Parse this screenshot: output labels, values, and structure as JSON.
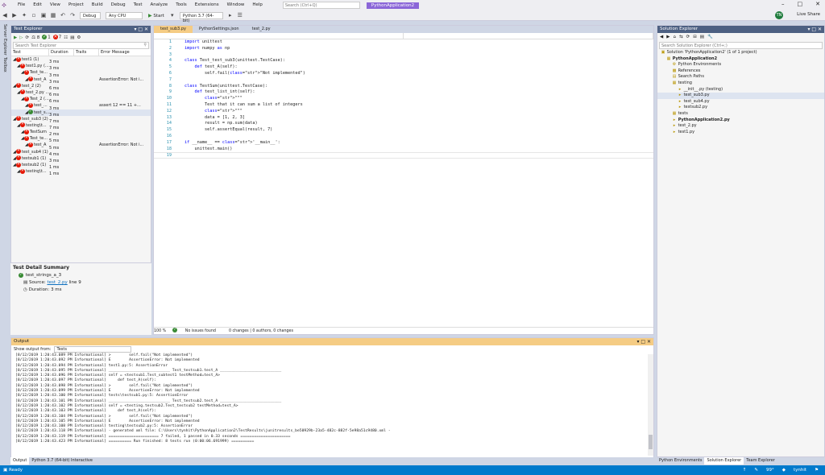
{
  "menubar": {
    "items": [
      "File",
      "Edit",
      "View",
      "Project",
      "Build",
      "Debug",
      "Test",
      "Analyze",
      "Tools",
      "Extensions",
      "Window",
      "Help"
    ],
    "search_placeholder": "Search (Ctrl+Q)",
    "solution_name": "PythonApplication2"
  },
  "toolbar": {
    "config": "Debug",
    "platform": "Any CPU",
    "start": "Start",
    "env": "Python 3.7 (64-bit)",
    "avatar_initials": "TN",
    "live_share": "Live Share"
  },
  "left_strip": [
    "Server Explorer",
    "Toolbox"
  ],
  "test_explorer": {
    "title": "Test Explorer",
    "counts": {
      "total": "8",
      "passed": "1",
      "failed": "7"
    },
    "search_placeholder": "Search Test Explorer",
    "columns": [
      "Test",
      "Duration",
      "Traits",
      "Error Message"
    ],
    "rows": [
      {
        "name": "test1 (1)",
        "duration": "3 ms",
        "traits": "",
        "error": "",
        "status": "fail",
        "indent": 0
      },
      {
        "name": "test1.py (...",
        "duration": "3 ms",
        "traits": "",
        "error": "",
        "status": "fail",
        "indent": 1
      },
      {
        "name": "Test_te...",
        "duration": "3 ms",
        "traits": "",
        "error": "",
        "status": "fail",
        "indent": 2
      },
      {
        "name": "test_A",
        "duration": "3 ms",
        "traits": "",
        "error": "AssertionError: Not i...",
        "status": "fail",
        "indent": 3
      },
      {
        "name": "test_2 (2)",
        "duration": "6 ms",
        "traits": "",
        "error": "",
        "status": "fail",
        "indent": 0
      },
      {
        "name": "test_2.py ...",
        "duration": "6 ms",
        "traits": "",
        "error": "",
        "status": "fail",
        "indent": 1
      },
      {
        "name": "Test_2 (...",
        "duration": "6 ms",
        "traits": "",
        "error": "",
        "status": "fail",
        "indent": 2
      },
      {
        "name": "test_...",
        "duration": "3 ms",
        "traits": "",
        "error": "assert 12 == 11 +...",
        "status": "fail",
        "indent": 3
      },
      {
        "name": "test_s...",
        "duration": "3 ms",
        "traits": "",
        "error": "",
        "status": "pass",
        "indent": 3,
        "selected": true
      },
      {
        "name": "test_sub3 (2)",
        "duration": "7 ms",
        "traits": "",
        "error": "",
        "status": "fail",
        "indent": 0
      },
      {
        "name": "testing\\t...",
        "duration": "7 ms",
        "traits": "",
        "error": "",
        "status": "fail",
        "indent": 1
      },
      {
        "name": "TestSum",
        "duration": "2 ms",
        "traits": "",
        "error": "",
        "status": "fail",
        "indent": 2
      },
      {
        "name": "Test_te...",
        "duration": "5 ms",
        "traits": "",
        "error": "",
        "status": "fail",
        "indent": 2
      },
      {
        "name": "test_A",
        "duration": "5 ms",
        "traits": "",
        "error": "AssertionError: Not i...",
        "status": "fail",
        "indent": 3
      },
      {
        "name": "test_sub4 (1)",
        "duration": "4 ms",
        "traits": "",
        "error": "",
        "status": "fail",
        "indent": 0
      },
      {
        "name": "testsub1 (1)",
        "duration": "3 ms",
        "traits": "",
        "error": "",
        "status": "fail",
        "indent": 0
      },
      {
        "name": "testsub2 (1)",
        "duration": "1 ms",
        "traits": "",
        "error": "",
        "status": "fail",
        "indent": 0
      },
      {
        "name": "testing\\t...",
        "duration": "1 ms",
        "traits": "",
        "error": "",
        "status": "fail",
        "indent": 1
      }
    ]
  },
  "test_detail": {
    "title": "Test Detail Summary",
    "test_name": "test_strings_a_3",
    "source_label": "Source:",
    "source_file": "test_2.py",
    "source_line": "line 9",
    "duration_label": "Duration:",
    "duration": "3 ms"
  },
  "editor": {
    "tabs": [
      {
        "label": "test_sub3.py",
        "active": true
      },
      {
        "label": "PythonSettings.json",
        "active": false
      },
      {
        "label": "test_2.py",
        "active": false
      }
    ],
    "code_lines": [
      "import unittest",
      "import numpy as np",
      "",
      "class Test_test_sub3(unittest.TestCase):",
      "    def test_A(self):",
      "        self.fail(\"Not implemented\")",
      "",
      "class TestSum(unittest.TestCase):",
      "    def test_list_int(self):",
      "        \"\"\"",
      "        Test that it can sum a list of integers",
      "        \"\"\"",
      "        data = [1, 2, 3]",
      "        result = np.sum(data)",
      "        self.assertEqual(result, 7)",
      "",
      "if __name__ == '__main__':",
      "    unittest.main()",
      ""
    ],
    "status": {
      "zoom": "100 %",
      "issues": "No issues found",
      "changes": "0 changes | 0 authors, 0 changes"
    }
  },
  "output": {
    "title": "Output",
    "show_from_label": "Show output from:",
    "source": "Tests",
    "lines": [
      "[8/12/2019 1:20:43.089 PM Informational] >        self.fail(\"Not implemented\")",
      "[8/12/2019 1:20:43.092 PM Informational] E        AssertionError: Not implemented",
      "[8/12/2019 1:20:43.094 PM Informational] test1.py:5: AssertionError",
      "[8/12/2019 1:20:43.095 PM Informational] ___________________________ Test_testsub1.test_A ___________________________",
      "[8/12/2019 1:20:43.096 PM Informational] self = <testsub1.Test_subtest1 testMethod=test_A>",
      "[8/12/2019 1:20:43.097 PM Informational]     def test_A(self):",
      "[8/12/2019 1:20:43.098 PM Informational] >        self.fail(\"Not implemented\")",
      "[8/12/2019 1:20:43.099 PM Informational] E        AssertionError: Not implemented",
      "[8/12/2019 1:20:43.100 PM Informational] tests\\testsub1.py:5: AssertionError",
      "[8/12/2019 1:20:43.101 PM Informational] ___________________________ Test_testsub2.test_A ___________________________",
      "[8/12/2019 1:20:43.102 PM Informational] self = <testing.testsub2.Test_testsub2 testMethod=test_A>",
      "[8/12/2019 1:20:43.103 PM Informational]     def test_A(self):",
      "[8/12/2019 1:20:43.104 PM Informational] >        self.fail(\"Not implemented\")",
      "[8/12/2019 1:20:43.105 PM Informational] E        AssertionError: Not implemented",
      "[8/12/2019 1:20:43.108 PM Informational] testing\\testsub2.py:5: AssertionError",
      "[8/12/2019 1:20:43.118 PM Informational] - generated xml file: C:\\Users\\tynhit\\PythonApplication2\\TestResults\\junitresults_be50929b-23a5-482c-882f-5e98a51c9480.xml -",
      "[8/12/2019 1:20:43.119 PM Informational] ====================== 7 failed, 1 passed in 0.33 seconds ======================",
      "[8/12/2019 1:20:43.423 PM Informational] ========== Run finished: 8 tests run (0:00:06.691999) =========="
    ],
    "bottom_tabs": [
      "Output",
      "Python 3.7 (64-bit) Interactive"
    ]
  },
  "solution_explorer": {
    "title": "Solution Explorer",
    "search_placeholder": "Search Solution Explorer (Ctrl+;)",
    "rows": [
      {
        "label": "Solution 'PythonApplication2' (1 of 1 project)",
        "indent": 0,
        "icon": "solution",
        "bold": false
      },
      {
        "label": "PythonApplication2",
        "indent": 1,
        "icon": "project",
        "bold": true
      },
      {
        "label": "Python Environments",
        "indent": 2,
        "icon": "env",
        "bold": false
      },
      {
        "label": "References",
        "indent": 2,
        "icon": "ref",
        "bold": false
      },
      {
        "label": "Search Paths",
        "indent": 2,
        "icon": "path",
        "bold": false
      },
      {
        "label": "testing",
        "indent": 2,
        "icon": "folder",
        "bold": false
      },
      {
        "label": "__init__.py (testing)",
        "indent": 3,
        "icon": "py",
        "bold": false
      },
      {
        "label": "test_sub3.py",
        "indent": 3,
        "icon": "py",
        "bold": false,
        "selected": true
      },
      {
        "label": "test_sub4.py",
        "indent": 3,
        "icon": "py",
        "bold": false
      },
      {
        "label": "testsub2.py",
        "indent": 3,
        "icon": "py",
        "bold": false
      },
      {
        "label": "tests",
        "indent": 2,
        "icon": "folder",
        "bold": false
      },
      {
        "label": "PythonApplication2.py",
        "indent": 2,
        "icon": "py",
        "bold": true
      },
      {
        "label": "test_2.py",
        "indent": 2,
        "icon": "py",
        "bold": false
      },
      {
        "label": "test1.py",
        "indent": 2,
        "icon": "py",
        "bold": false
      }
    ],
    "bottom_tabs": [
      "Python Environments",
      "Solution Explorer",
      "Team Explorer"
    ]
  },
  "statusbar": {
    "left": "Ready",
    "zoom": "99°",
    "user": "tynhit"
  },
  "colors": {
    "title_bar": "#4d6082",
    "status_bar": "#007acc",
    "accent_tab": "#f5cc84",
    "fail": "#e51400",
    "pass": "#388a34"
  }
}
